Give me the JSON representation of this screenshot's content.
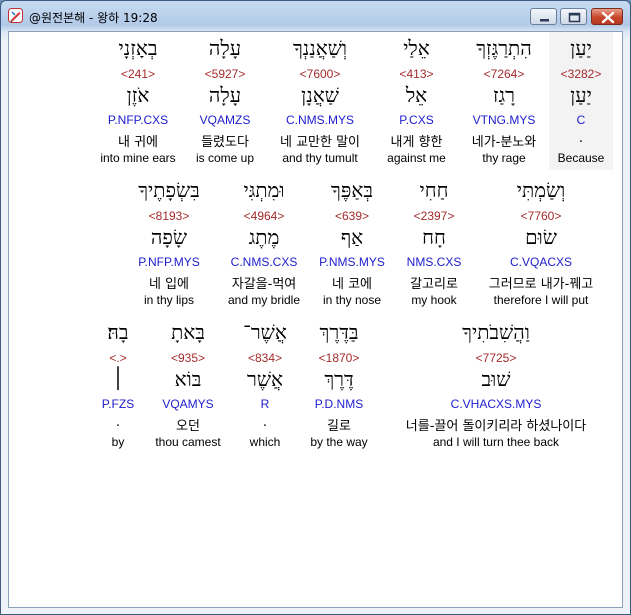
{
  "window": {
    "title": "@원전본해 - 왕하 19:28",
    "icon": "app-pen-icon",
    "controls": [
      "minimize",
      "maximize",
      "close"
    ]
  },
  "rows": [
    [
      {
        "heb": "יַעַן",
        "num": "<3282>",
        "lex": "יַעַן",
        "morph": "C",
        "kor": ".",
        "eng": "Because",
        "highlight": true
      },
      {
        "heb": "הִתְרַגֶּזְךָ",
        "num": "<7264>",
        "lex": "רָגַז",
        "morph": "VTNG.MYS",
        "kor": "네가-분노와",
        "eng": "thy rage"
      },
      {
        "heb": "אֵלַי",
        "num": "<413>",
        "lex": "אֵל",
        "morph": "P.CXS",
        "kor": "내게 향한",
        "eng": "against me"
      },
      {
        "heb": "וְשַׁאֲנַנְךָ",
        "num": "<7600>",
        "lex": "שַׁאֲנָן",
        "morph": "C.NMS.MYS",
        "kor": "네 교만한 말이",
        "eng": "and thy tumult"
      },
      {
        "heb": "עָלָה",
        "num": "<5927>",
        "lex": "עָלָה",
        "morph": "VQAMZS",
        "kor": "들렸도다",
        "eng": "is come up"
      },
      {
        "heb": "בְאָזְנָי",
        "num": "<241>",
        "lex": "אֹזֶן",
        "morph": "P.NFP.CXS",
        "kor": "내 귀에",
        "eng": "into mine ears"
      }
    ],
    [
      {
        "heb": "וְשַׂמְתִּי",
        "num": "<7760>",
        "lex": "שׂוּם",
        "morph": "C.VQACXS",
        "kor": "그러므로 내가-꿰고",
        "eng": "therefore I will put"
      },
      {
        "heb": "חַחִי",
        "num": "<2397>",
        "lex": "חָח",
        "morph": "NMS.CXS",
        "kor": "갈고리로",
        "eng": "my hook"
      },
      {
        "heb": "בְּאַפֶּךָ",
        "num": "<639>",
        "lex": "אַף",
        "morph": "P.NMS.MYS",
        "kor": "네 코에",
        "eng": "in thy nose"
      },
      {
        "heb": "וּמִתְגִּי",
        "num": "<4964>",
        "lex": "מֶתֶג",
        "morph": "C.NMS.CXS",
        "kor": "자갈을-먹여",
        "eng": "and my bridle"
      },
      {
        "heb": "בִּשְׂפָתֶיךָ",
        "num": "<8193>",
        "lex": "שָׂפָה",
        "morph": "P.NFP.MYS",
        "kor": "네 입에",
        "eng": "in thy lips"
      }
    ],
    [
      {
        "heb": "וַהֲשִׁבֹתִיךָ",
        "num": "<7725>",
        "lex": "שׁוּב",
        "morph": "C.VHACXS.MYS",
        "kor": "너를-끌어 돌이키리라 하셨나이다",
        "eng": "and I will turn thee back"
      },
      {
        "heb": "בַּדֶּרֶךְ",
        "num": "<1870>",
        "lex": "דֶּרֶךְ",
        "morph": "P.D.NMS",
        "kor": "길로",
        "eng": "by the way"
      },
      {
        "heb": "אֲשֶׁר־",
        "num": "<834>",
        "lex": "אֲשֶׁר",
        "morph": "R",
        "kor": ".",
        "eng": "which"
      },
      {
        "heb": "בָּאתָ",
        "num": "<935>",
        "lex": "בּוֹא",
        "morph": "VQAMYS",
        "kor": "오던",
        "eng": "thou camest"
      },
      {
        "heb": "בָהּ׃",
        "num": "<.>",
        "lex": "׀",
        "morph": "P.FZS",
        "kor": ".",
        "eng": "by"
      }
    ]
  ]
}
